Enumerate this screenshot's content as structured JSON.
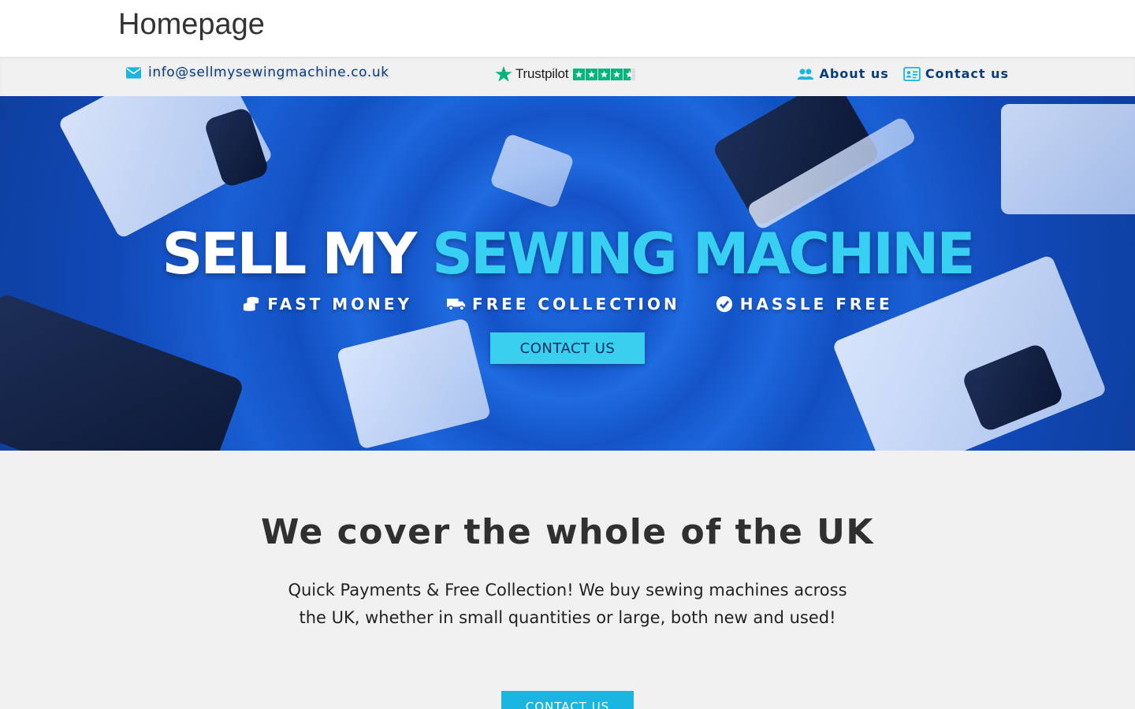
{
  "header": {
    "title": "Homepage"
  },
  "topbar": {
    "email": "info@sellmysewingmachine.co.uk",
    "trustpilot": {
      "brand": "Trustpilot",
      "rating_fraction": 0.9
    },
    "nav": [
      {
        "label": "About us",
        "icon": "users-icon"
      },
      {
        "label": "Contact us",
        "icon": "contact-card-icon"
      }
    ]
  },
  "hero": {
    "title_part1": "SELL MY ",
    "title_part2": "SEWING MACHINE",
    "features": [
      {
        "label": "FAST MONEY",
        "icon": "coins-icon"
      },
      {
        "label": "FREE COLLECTION",
        "icon": "truck-icon"
      },
      {
        "label": "HASSLE FREE",
        "icon": "check-circle-icon"
      }
    ],
    "cta_label": "CONTACT US"
  },
  "main": {
    "heading": "We cover the whole of the UK",
    "text": "Quick Payments & Free Collection! We buy sewing machines across the UK, whether in small quantities or large, both new and used!",
    "cta_label": "CONTACT US"
  },
  "colors": {
    "brand_dark": "#0a3d7c",
    "accent_cyan": "#1ab6e0",
    "trustpilot_green": "#00b67a",
    "hero_blue": "#1552c8"
  }
}
